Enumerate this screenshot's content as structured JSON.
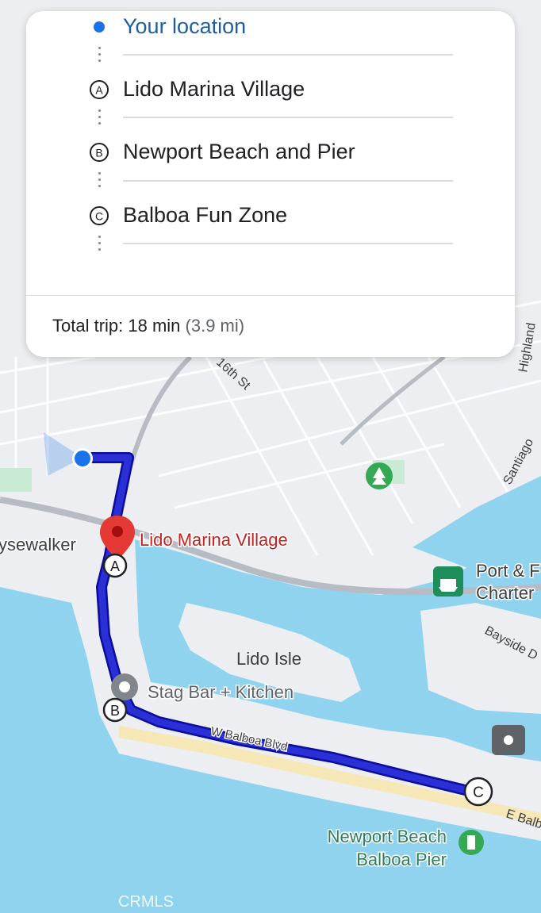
{
  "route_card": {
    "origin_label": "Your location",
    "stops": [
      {
        "marker": "A",
        "name": "Lido Marina Village"
      },
      {
        "marker": "B",
        "name": "Newport Beach and Pier"
      },
      {
        "marker": "C",
        "name": "Balboa Fun Zone"
      }
    ],
    "total_label": "Total trip: 18 min",
    "total_distance": "(3.9 mi)"
  },
  "map": {
    "place_labels": {
      "lido_marina_village": "Lido Marina Village",
      "lido_isle": "Lido Isle",
      "stag_bar": "Stag Bar + Kitchen",
      "newport_pier_line1": "Newport Beach",
      "newport_pier_line2": "Balboa Pier",
      "port_line1": "Port & F",
      "port_line2": "Charter",
      "sewalker": "ysewalker"
    },
    "street_labels": {
      "w_balboa": "W Balboa Blvd",
      "e_balboa": "E Balb",
      "bayside": "Bayside D",
      "sixteenth": "16th St",
      "santiago": "Santiago",
      "highland": "Highland"
    },
    "route_markers": {
      "a": "A",
      "b": "B",
      "c": "C"
    },
    "watermark": "CRMLS",
    "colors": {
      "water": "#8fd3ef",
      "land": "#eceef1",
      "beach": "#f6e7b7",
      "park": "#c9ebd4",
      "route": "#2b2fd6",
      "route_border": "#0b0d9c",
      "pin": "#e53935",
      "origin_dot": "#1a73e8"
    }
  }
}
